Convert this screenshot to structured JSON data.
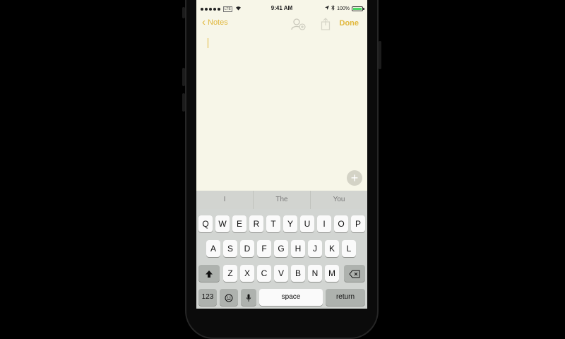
{
  "status_bar": {
    "carrier": "LTE",
    "time": "9:41 AM",
    "battery": "100%"
  },
  "navbar": {
    "back_label": "Notes",
    "done_label": "Done"
  },
  "note": {
    "text": ""
  },
  "suggestions": [
    "I",
    "The",
    "You"
  ],
  "keyboard": {
    "row1": [
      "Q",
      "W",
      "E",
      "R",
      "T",
      "Y",
      "U",
      "I",
      "O",
      "P"
    ],
    "row2": [
      "A",
      "S",
      "D",
      "F",
      "G",
      "H",
      "J",
      "K",
      "L"
    ],
    "row3": [
      "Z",
      "X",
      "C",
      "V",
      "B",
      "N",
      "M"
    ],
    "numbers_label": "123",
    "space_label": "space",
    "return_label": "return"
  },
  "colors": {
    "accent": "#e1b83d",
    "note_background": "#f7f6e8",
    "keyboard_background": "#d2d5d2"
  }
}
